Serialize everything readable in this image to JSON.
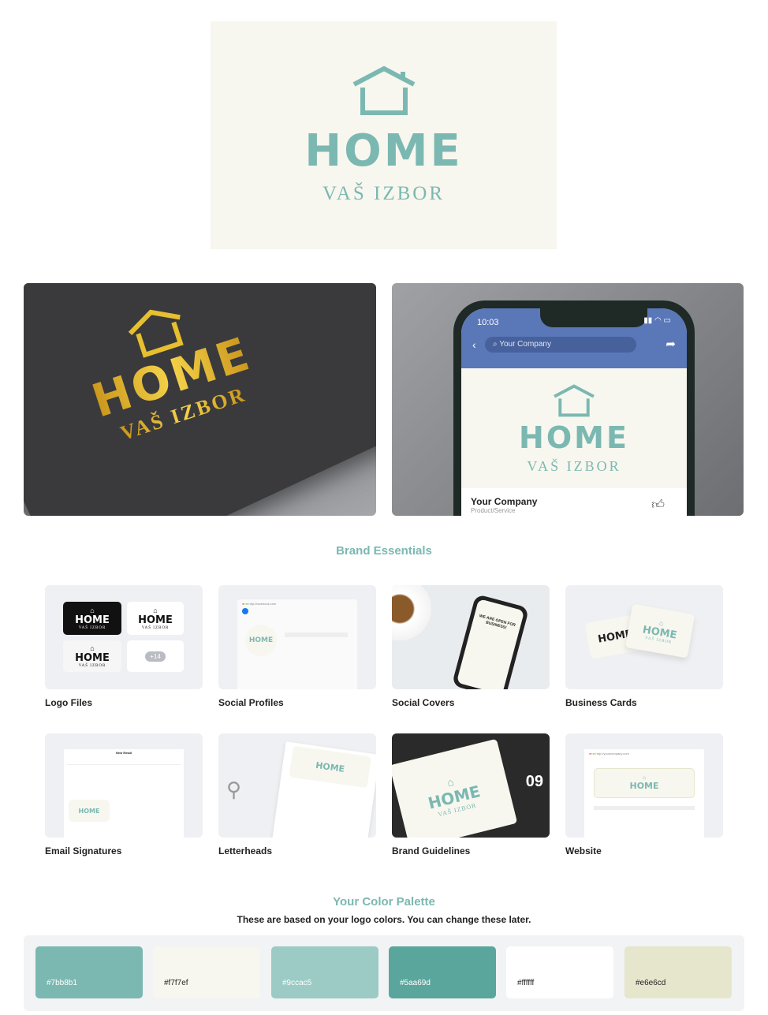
{
  "logo": {
    "name": "HOME",
    "tagline": "VAŠ IZBOR",
    "icon": "house-outline-icon"
  },
  "mockups": {
    "foil": {
      "name": "HOME",
      "tagline": "VAŠ IZBOR"
    },
    "phone": {
      "time": "10:03",
      "search": "Your Company",
      "name": "HOME",
      "tagline": "VAŠ IZBOR",
      "page_name": "Your Company",
      "page_category": "Product/Service"
    }
  },
  "brand_essentials": {
    "title": "Brand Essentials",
    "items": [
      {
        "label": "Logo Files",
        "extra_count": "+14"
      },
      {
        "label": "Social Profiles",
        "url": "http://facebook.com"
      },
      {
        "label": "Social Covers",
        "cover_text": "WE ARE OPEN FOR BUSINESS!"
      },
      {
        "label": "Business Cards"
      },
      {
        "label": "Email Signatures",
        "window_title": "New Email"
      },
      {
        "label": "Letterheads"
      },
      {
        "label": "Brand Guidelines",
        "page_number": "09"
      },
      {
        "label": "Website",
        "url": "http://yourcompany.com"
      }
    ]
  },
  "palette": {
    "title": "Your Color Palette",
    "subtitle": "These are based on your logo colors. You can change these later.",
    "colors": [
      {
        "hex": "#7bb8b1",
        "text_color": "#ffffff"
      },
      {
        "hex": "#f7f7ef",
        "text_color": "#222222"
      },
      {
        "hex": "#9ccac5",
        "text_color": "#ffffff"
      },
      {
        "hex": "#5aa69d",
        "text_color": "#ffffff"
      },
      {
        "hex": "#ffffff",
        "text_color": "#222222"
      },
      {
        "hex": "#e6e6cd",
        "text_color": "#222222"
      }
    ]
  }
}
